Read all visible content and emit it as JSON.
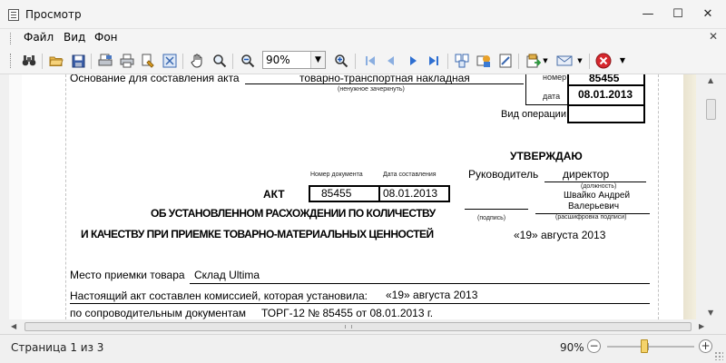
{
  "window": {
    "title": "Просмотр",
    "controls": {
      "minimize": "—",
      "maximize": "☐",
      "close": "✕"
    }
  },
  "menu": {
    "items": [
      "Файл",
      "Вид",
      "Фон"
    ],
    "close_glyph": "✕"
  },
  "toolbar": {
    "zoom_value": "90%",
    "icons": [
      "binoculars-icon",
      "open-folder-icon",
      "save-icon",
      "page-setup-icon",
      "print-icon",
      "print-quick-icon",
      "fit-page-icon",
      "hand-icon",
      "zoom-out-icon",
      "zoom-in-icon",
      "first-page-icon",
      "previous-page-icon",
      "next-page-icon",
      "last-page-icon",
      "multiple-pages-icon",
      "color-icon",
      "watermark-icon",
      "export-icon",
      "email-icon",
      "close-preview-icon"
    ]
  },
  "document": {
    "basis_label": "Основание для составления акта",
    "basis_value": "товарно-транспортная накладная",
    "basis_hint": "(ненужное зачеркнуть)",
    "number_label": "номер",
    "number_value": "85455",
    "date_label": "дата",
    "date_value": "08.01.2013",
    "operation_label": "Вид операции:",
    "approve_title": "УТВЕРЖДАЮ",
    "manager_label": "Руководитель",
    "manager_position": "директор",
    "position_hint": "(должность)",
    "manager_name_line1": "Швайко Андрей",
    "manager_name_line2": "Валерьевич",
    "signature_hint": "(подпись)",
    "decode_hint": "(расшифровка подписи)",
    "approve_date": "«19» августа 2013",
    "doc_number_header": "Номер документа",
    "doc_date_header": "Дата составления",
    "act_label": "АКТ",
    "act_number": "85455",
    "act_date": "08.01.2013",
    "act_title_line1": "ОБ УСТАНОВЛЕННОМ РАСХОЖДЕНИИ ПО КОЛИЧЕСТВУ",
    "act_title_line2": "И КАЧЕСТВУ ПРИ ПРИЕМКЕ ТОВАРНО-МАТЕРИАЛЬНЫХ ЦЕННОСТЕЙ",
    "place_label": "Место приемки товара",
    "place_value": "Склад Ultima",
    "commission_label": "Настоящий акт составлен комиссией, которая установила:",
    "commission_value": "«19» августа 2013",
    "docs_label": "по сопроводительным документам",
    "docs_value": "ТОРГ-12 № 85455 от 08.01.2013 г."
  },
  "statusbar": {
    "page_text": "Страница 1 из 3",
    "zoom_text": "90%",
    "zoom_level_percent": 90
  }
}
